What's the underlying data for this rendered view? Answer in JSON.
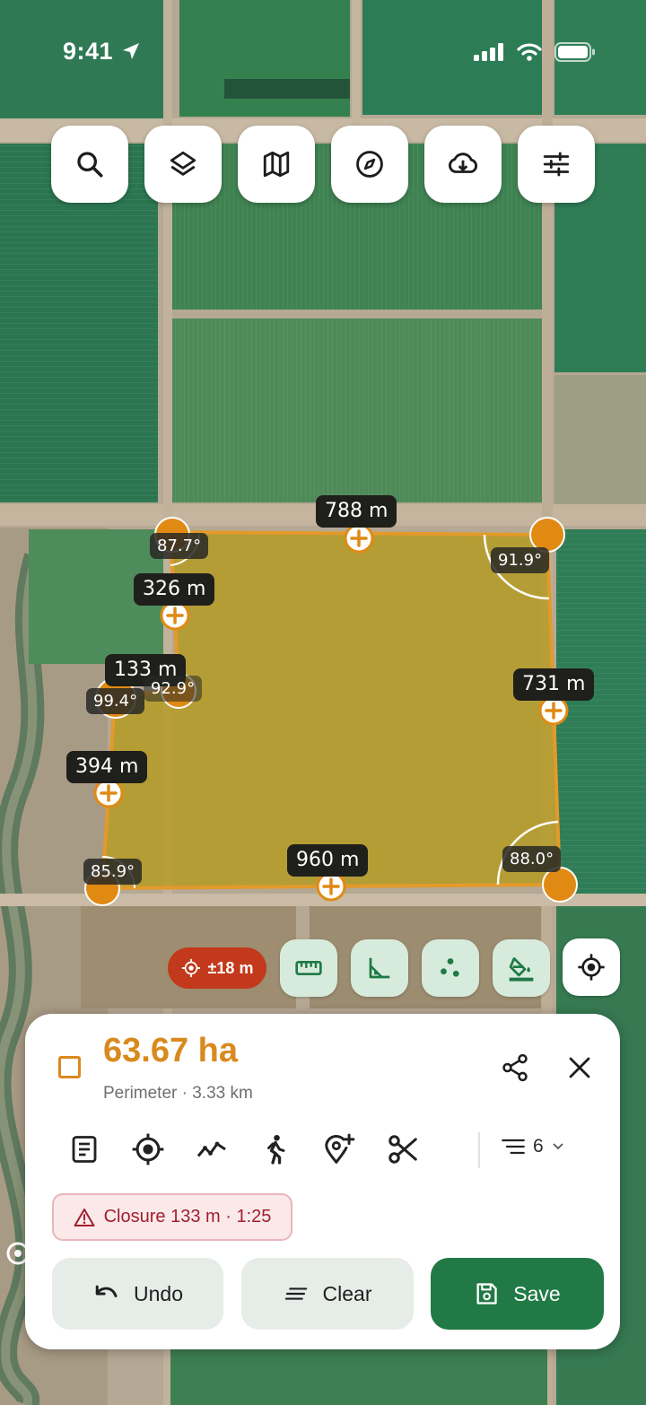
{
  "status_bar": {
    "time": "9:41"
  },
  "toolbar": {
    "buttons": [
      {
        "icon": "search-icon"
      },
      {
        "icon": "layers-icon"
      },
      {
        "icon": "map-icon"
      },
      {
        "icon": "compass-icon"
      },
      {
        "icon": "cloud-download-icon"
      },
      {
        "icon": "sliders-icon"
      }
    ]
  },
  "map": {
    "segment_lengths": {
      "top": "788 m",
      "upper_left": "326 m",
      "notch": "133 m",
      "right": "731 m",
      "lower_left": "394 m",
      "bottom": "960 m"
    },
    "vertex_angles": {
      "top_left": "87.7°",
      "top_right": "91.9°",
      "notch_inner": "92.9°",
      "notch_outer": "99.4°",
      "bottom_left": "85.9°",
      "bottom_right": "88.0°"
    },
    "colors": {
      "polygon_stroke": "#e39a2a",
      "polygon_fill": "#c99a1c",
      "vertex": "#e08a14"
    }
  },
  "controls": {
    "gps_accuracy": "±18 m",
    "accuracy_color": "#c2391b",
    "buttons": [
      "ruler-icon",
      "angle-icon",
      "points-icon",
      "fill-icon",
      "locate-icon"
    ]
  },
  "sheet": {
    "area": "63.67 ha",
    "perimeter": "Perimeter · 3.33 km",
    "layer_count": "6",
    "closure": "Closure 133 m · 1:25",
    "undo_label": "Undo",
    "clear_label": "Clear",
    "save_label": "Save",
    "accent": "#d98a1e",
    "save_color": "#217a45"
  }
}
